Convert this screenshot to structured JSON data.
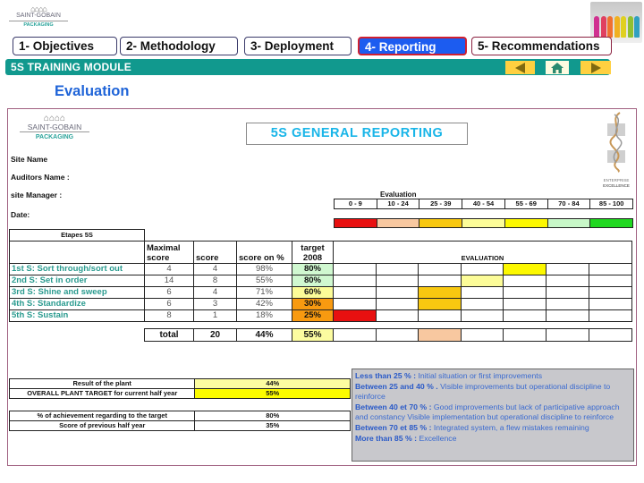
{
  "header": {
    "company_logo": {
      "name": "SAINT-GOBAIN",
      "division": "PACKAGING"
    },
    "tabs": [
      {
        "label": "1- Objectives",
        "active": false
      },
      {
        "label": "2- Methodology",
        "active": false
      },
      {
        "label": "3- Deployment",
        "active": false
      },
      {
        "label": "4- Reporting",
        "active": true
      },
      {
        "label": "5- Recommendations",
        "active": false
      }
    ],
    "module_title": "5S TRAINING MODULE",
    "nav": {
      "prev_icon": "arrow-left-icon",
      "home_icon": "home-icon",
      "next_icon": "arrow-right-icon"
    },
    "bottles_logo_colors": [
      "#d03090",
      "#e04060",
      "#f07030",
      "#f0b020",
      "#e0d020",
      "#90c030",
      "#30a0c0"
    ]
  },
  "page_title": "Evaluation",
  "report": {
    "logo": {
      "name": "SAINT-GOBAIN",
      "division": "PACKAGING"
    },
    "title": "5S GENERAL REPORTING",
    "ee_logo_text": [
      "ENTERPRISE",
      "EXCELLENCE"
    ],
    "fields": [
      {
        "label": "Site Name"
      },
      {
        "label": "Auditors Name :"
      },
      {
        "label": "site Manager :"
      },
      {
        "label": "Date:"
      }
    ],
    "scale": {
      "title": "Evaluation",
      "ranges": [
        "0 - 9",
        "10 - 24",
        "25 - 39",
        "40 - 54",
        "55 - 69",
        "70 - 84",
        "85 - 100"
      ],
      "colors": [
        "#e81010",
        "#f8c8a0",
        "#f8c810",
        "#fcfc98",
        "#fcf800",
        "#c8f8c8",
        "#20d820"
      ]
    },
    "table": {
      "section_header": "Etapes 5S",
      "columns": [
        "Maximal score",
        "score",
        "score on %",
        "target 2008",
        "EVALUATION"
      ],
      "col_maximal_1": "Maximal",
      "col_maximal_2": "score",
      "col_target_1": "target",
      "col_target_2": "2008",
      "rows": [
        {
          "label": "1st S: Sort through/sort out",
          "max": "4",
          "score": "4",
          "pct": "98%",
          "target": "80%",
          "target_color": "#d0f8d0",
          "eval_col": 4
        },
        {
          "label": "2nd S: Set in order",
          "max": "14",
          "score": "8",
          "pct": "55%",
          "target": "80%",
          "target_color": "#d0f8d0",
          "eval_col": 3
        },
        {
          "label": "3rd S: Shine and sweep",
          "max": "6",
          "score": "4",
          "pct": "71%",
          "target": "60%",
          "target_color": "#fcfc98",
          "eval_col": 2
        },
        {
          "label": "4th S: Standardize",
          "max": "6",
          "score": "3",
          "pct": "42%",
          "target": "30%",
          "target_color": "#f89a10",
          "eval_col": 2
        },
        {
          "label": "5th S: Sustain",
          "max": "8",
          "score": "1",
          "pct": "18%",
          "target": "25%",
          "target_color": "#f89a10",
          "eval_col": 0
        }
      ],
      "total": {
        "label": "total",
        "score": "20",
        "pct": "44%",
        "target": "55%",
        "eval_col": 2
      }
    },
    "results": [
      {
        "label": "Result of the plant",
        "value": "44%",
        "color": "#fcfca0"
      },
      {
        "label": "OVERALL PLANT TARGET for current half year",
        "value": "55%",
        "color": "#fcfc00"
      }
    ],
    "achievement": [
      {
        "label": "% of achievement regarding to the target",
        "value": "80%"
      },
      {
        "label": "Score of previous half year",
        "value": "35%"
      }
    ],
    "explanation": [
      {
        "range": "Less than 25 % :",
        "text": " Initial situation or first improvements"
      },
      {
        "range": "Between 25 and 40 % .",
        "text": " Visible improvements but operational discipline to reinforce"
      },
      {
        "range": "Between 40 et 70 % :",
        "text": " Good improvements but lack of participative approach and constancy Visible implementation but operational discipline to reinforce"
      },
      {
        "range": "Between 70 et 85 % :",
        "text": " Integrated system, a flew mistakes remaining"
      },
      {
        "range": "More than 85 % :",
        "text": " Excellence"
      }
    ]
  }
}
